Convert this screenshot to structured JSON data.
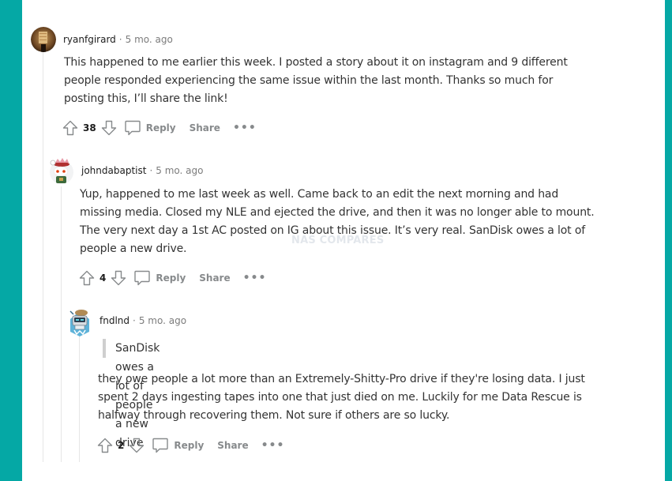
{
  "colors": {
    "frame": "#05a8a5",
    "thread_line": "#e6e6e6",
    "action_gray": "#878a8c",
    "body_text": "#333333"
  },
  "watermark": "NAS COMPARES",
  "comments": [
    {
      "author": "ryanfgirard",
      "separator": "·",
      "age": "5 mo. ago",
      "avatar": "photo-avatar",
      "body": "This happened to me earlier this week. I posted a story about it on instagram and 9 different people responded experiencing the same issue within the last month. Thanks so much for posting this, I’ll share the link!",
      "body_lines": [
        "This happened to me earlier this week. I posted a story about it on instagram and 9 different",
        "people responded experiencing the same issue within the last month. Thanks so much for",
        "posting this, I’ll share the link!"
      ],
      "votes": "38",
      "reply_label": "Reply",
      "share_label": "Share",
      "more_label": "•••"
    },
    {
      "author": "johndabaptist",
      "separator": "·",
      "age": "5 mo. ago",
      "avatar": "snoo-avatar-flower-hat",
      "body_lines": [
        "Yup, happened to me last week as well. Came back to an edit the next morning and had",
        "missing media. Closed my NLE and ejected the drive, and then it was no longer able to mount.",
        "The very next day a 1st AC posted on IG about this issue. It’s very real. SanDisk owes a lot of",
        "people a new drive."
      ],
      "votes": "4",
      "reply_label": "Reply",
      "share_label": "Share",
      "more_label": "•••"
    },
    {
      "author": "fndlnd",
      "separator": "·",
      "age": "5 mo. ago",
      "avatar": "snoo-avatar-robot",
      "quote": "SanDisk owes a lot of people a new drive",
      "body_lines": [
        "they owe people a lot more than an Extremely-Shitty-Pro drive if they're losing data. I just",
        "spent 2 days ingesting tapes into one that just died on me. Luckily for me Data Rescue is",
        "halfway through recovering them. Not sure if others are so lucky."
      ],
      "votes": "2",
      "reply_label": "Reply",
      "share_label": "Share",
      "more_label": "•••"
    }
  ]
}
